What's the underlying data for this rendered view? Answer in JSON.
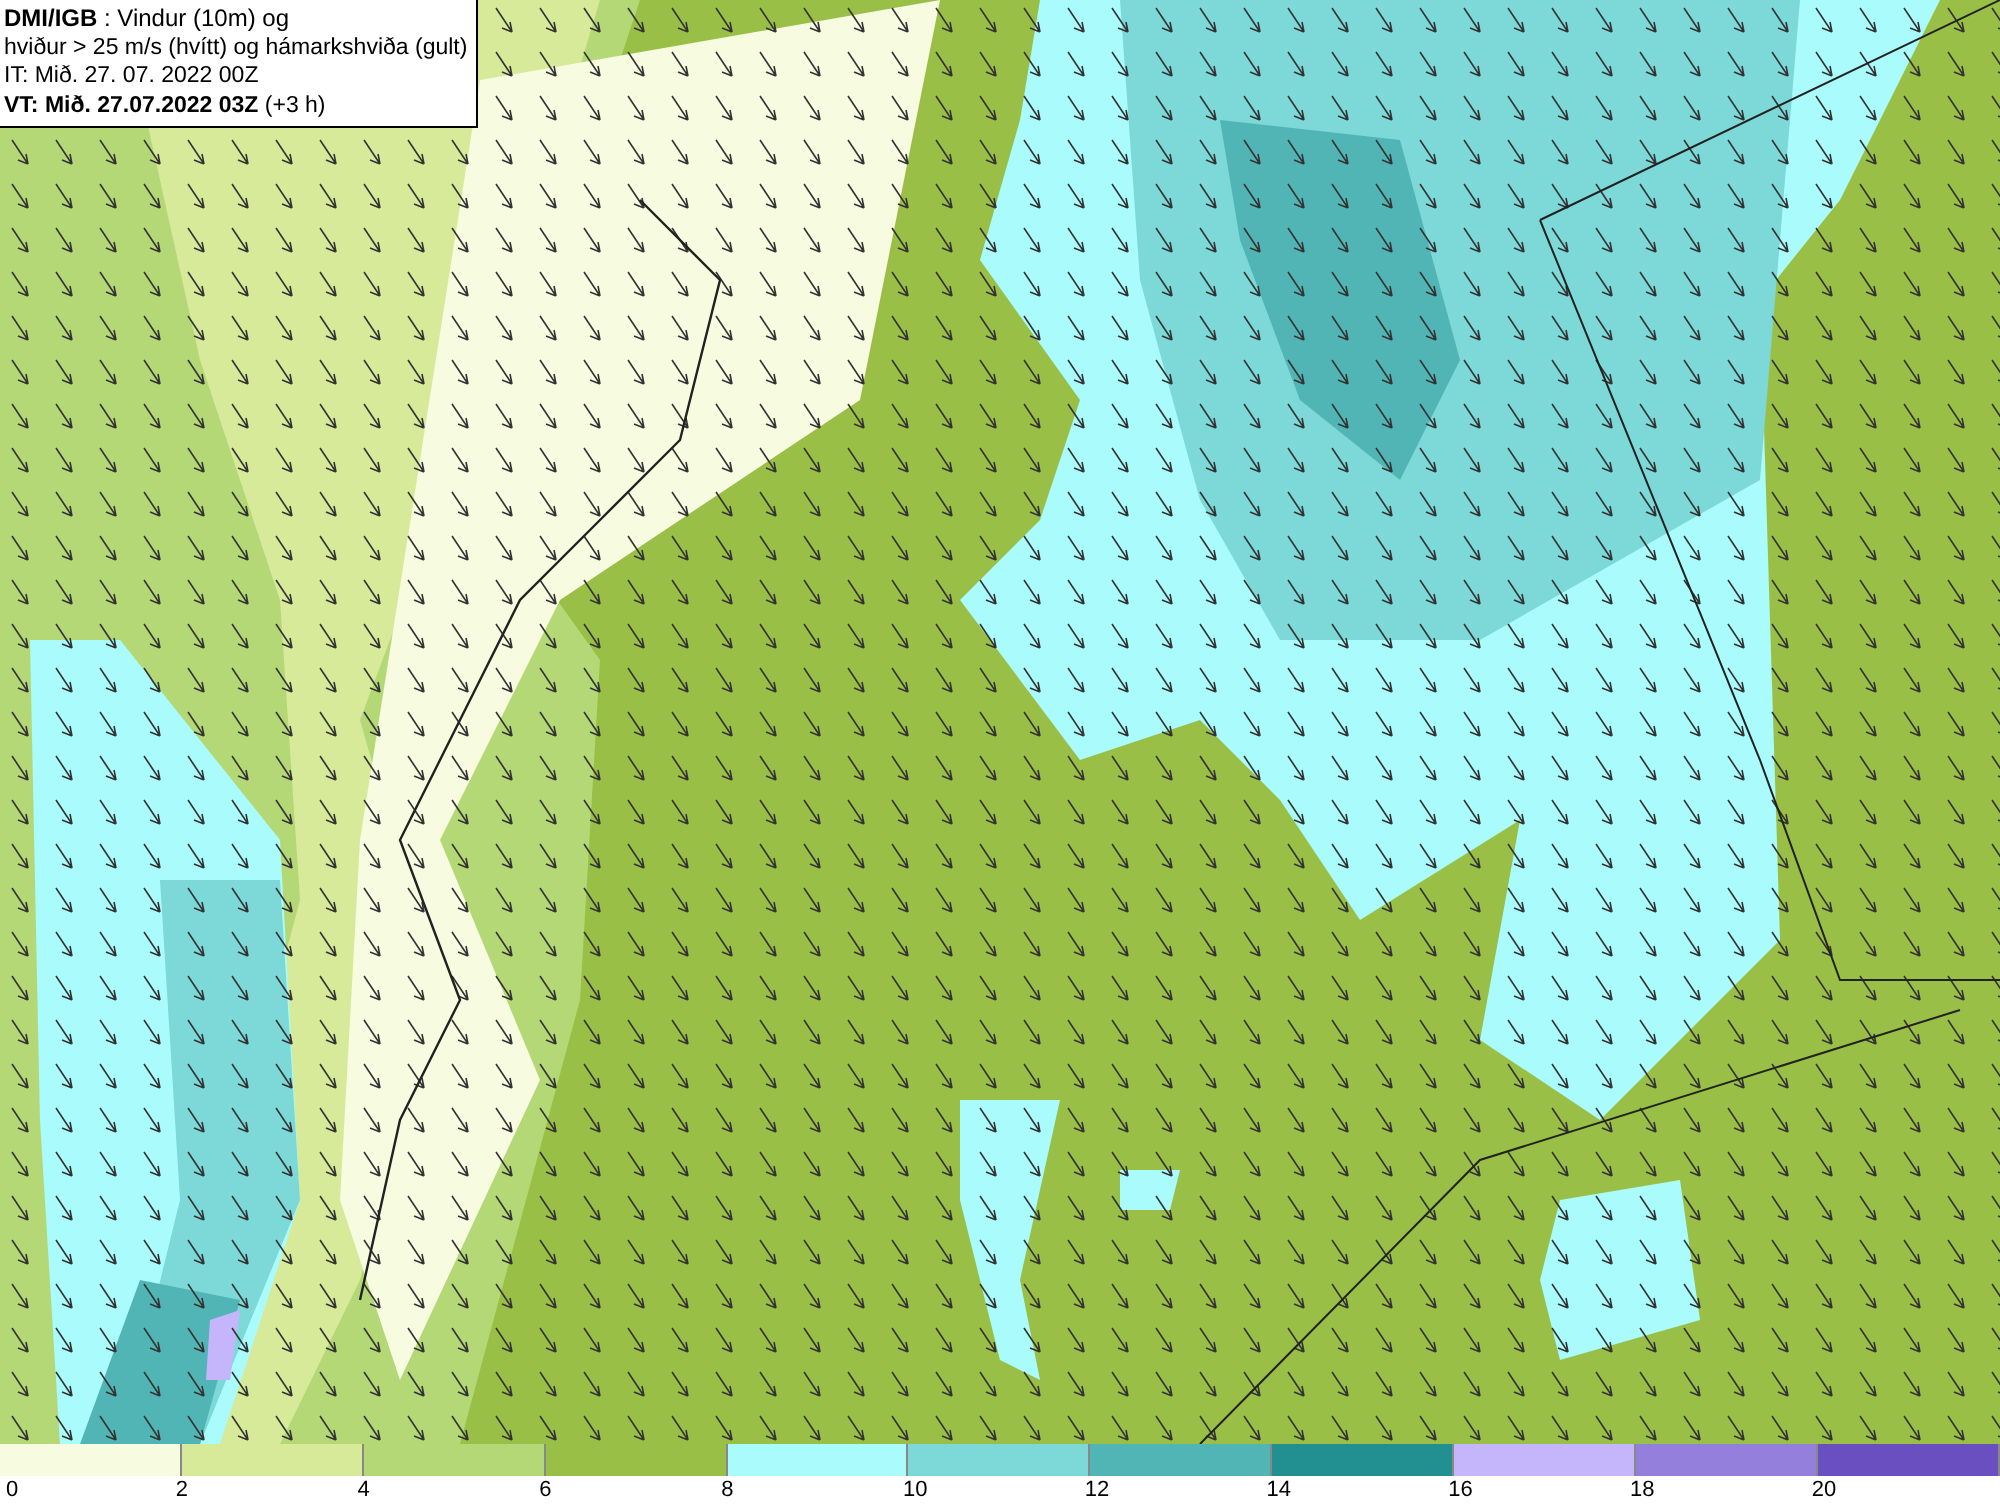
{
  "title_box": {
    "lines": [
      "**DMI/IGB** : Vindur (10m) og",
      "hviður > 25 m/s (hvítt) og hámarkshviða (gult)",
      "IT: Mið. 27. 07. 2022 00Z",
      "**VT: Mið. 27.07.2022 03Z** (+3 h)"
    ]
  },
  "legend": {
    "bins": [
      {
        "color": "#f7fbe0"
      },
      {
        "color": "#d6ea9a"
      },
      {
        "color": "#b5d877"
      },
      {
        "color": "#99bf47"
      },
      {
        "color": "#aafcfc"
      },
      {
        "color": "#7dd8d8"
      },
      {
        "color": "#52b5b5"
      },
      {
        "color": "#229090"
      },
      {
        "color": "#c5b5fb"
      },
      {
        "color": "#9480dc"
      },
      {
        "color": "#6a4fc0"
      }
    ],
    "labels": [
      "0",
      "2",
      "4",
      "6",
      "8",
      "10",
      "12",
      "14",
      "16",
      "18",
      "20"
    ]
  }
}
